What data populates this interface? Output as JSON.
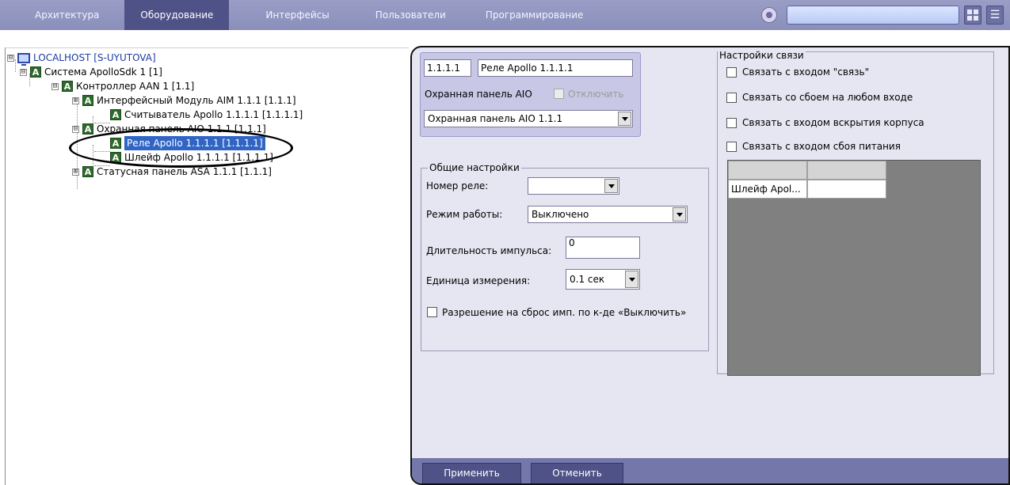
{
  "nav": {
    "tabs": [
      "Архитектура",
      "Оборудование",
      "Интерфейсы",
      "Пользователи",
      "Программирование"
    ],
    "active_tab": "Оборудование",
    "search_value": ""
  },
  "tree": {
    "nodes": [
      {
        "label": "LOCALHOST [S-UYUTOVA]",
        "expander": "⊟"
      },
      {
        "label": "Система ApolloSdk 1 [1]",
        "expander": "⊟"
      },
      {
        "label": "Контроллер AAN 1 [1.1]",
        "expander": "⊟"
      },
      {
        "label": "Интерфейсный Модуль AIM 1.1.1 [1.1.1]",
        "expander": "⊞"
      },
      {
        "label": "Считыватель Apollo 1.1.1.1 [1.1.1.1]",
        "expander": ""
      },
      {
        "label": "Охранная панель AIO 1.1.1 [1.1.1]",
        "expander": "⊟"
      },
      {
        "label": "Реле Apollo 1.1.1.1 [1.1.1.1]",
        "expander": ""
      },
      {
        "label": "Шлейф Apollo 1.1.1.1 [1.1.1.1]",
        "expander": ""
      },
      {
        "label": "Статусная панель ASA 1.1.1 [1.1.1]",
        "expander": "⊞"
      }
    ],
    "icon_letter": "A"
  },
  "object": {
    "id": "1.1.1.1",
    "name": "Реле Apollo 1.1.1.1",
    "parent_label": "Охранная панель AIO",
    "disable_label": "Отключить",
    "parent_select": "Охранная панель AIO 1.1.1"
  },
  "general": {
    "title": "Общие настройки",
    "relay_number_label": "Номер реле:",
    "relay_number_value": "",
    "mode_label": "Режим работы:",
    "mode_value": "Выключено",
    "pulse_label": "Длительность импульса:",
    "pulse_value": "0",
    "unit_label": "Единица измерения:",
    "unit_value": "0.1 сек",
    "reset_label": "Разрешение на сброс имп. по к-де «Выключить»"
  },
  "links": {
    "title": "Настройки связи",
    "options": [
      "Связать с входом \"связь\"",
      "Связать со сбоем на любом входе",
      "Связать с входом вскрытия корпуса",
      "Связать с входом сбоя питания"
    ],
    "grid_row": "Шлейф Apol..."
  },
  "buttons": {
    "apply": "Применить",
    "cancel": "Отменить"
  },
  "colors": {
    "tab_bar": "#8a8fbb",
    "tab_active": "#4f5287",
    "panel_bg": "#e6e6f2",
    "selection": "#3165c4",
    "button": "#4f5286"
  }
}
